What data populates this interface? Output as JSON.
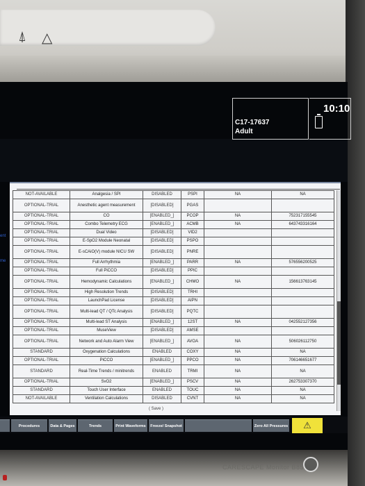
{
  "status": {
    "patient_id": "C17-17637",
    "patient_type": "Adult",
    "time": "10:10"
  },
  "side_labels": [
    "ent",
    "me"
  ],
  "table": {
    "rows": [
      {
        "status": "NOT-AVAILABLE",
        "feature": "Analgesia / SPI",
        "enabled": "DISABLED",
        "code": "PSPI",
        "value": "NA",
        "serial": "NA"
      },
      {
        "status": "OPTIONAL-TRIAL",
        "feature": "Anesthetic agent measurement",
        "enabled": "[DISABLED]",
        "code": "PGAS",
        "value": "",
        "serial": "",
        "tall": true
      },
      {
        "status": "OPTIONAL-TRIAL",
        "feature": "CO",
        "enabled": "[ENABLED_]",
        "code": "PCOP",
        "value": "NA",
        "serial": "752317155545"
      },
      {
        "status": "OPTIONAL-TRIAL",
        "feature": "Combo Telemetry ECG",
        "enabled": "[ENABLED_]",
        "code": "ACMB",
        "value": "NA",
        "serial": "643743316164"
      },
      {
        "status": "OPTIONAL-TRIAL",
        "feature": "Dual Video",
        "enabled": "[DISABLED]",
        "code": "VID2",
        "value": "",
        "serial": ""
      },
      {
        "status": "OPTIONAL-TRIAL",
        "feature": "E-SpO2 Module Neonatal",
        "enabled": "[DISABLED]",
        "code": "PSPO",
        "value": "",
        "serial": ""
      },
      {
        "status": "OPTIONAL-TRIAL",
        "feature": "E-sCAiO(V) module NICU SW",
        "enabled": "[DISABLED]",
        "code": "PNRE",
        "value": "",
        "serial": "",
        "tall": true
      },
      {
        "status": "OPTIONAL-TRIAL",
        "feature": "Full Arrhythmia",
        "enabled": "[ENABLED_]",
        "code": "PARR",
        "value": "NA",
        "serial": "576556200525"
      },
      {
        "status": "OPTIONAL-TRIAL",
        "feature": "Full PiCCO",
        "enabled": "[DISABLED]",
        "code": "PPIC",
        "value": "",
        "serial": ""
      },
      {
        "status": "OPTIONAL-TRIAL",
        "feature": "Hemodynamic Calculations",
        "enabled": "[ENABLED_]",
        "code": "CHMO",
        "value": "NA",
        "serial": "156613763145",
        "tall": true
      },
      {
        "status": "OPTIONAL-TRIAL",
        "feature": "High Resolution Trends",
        "enabled": "[DISABLED]",
        "code": "TRHI",
        "value": "",
        "serial": ""
      },
      {
        "status": "OPTIONAL-TRIAL",
        "feature": "LaunchPad License",
        "enabled": "[DISABLED]",
        "code": "AIPN",
        "value": "",
        "serial": ""
      },
      {
        "status": "OPTIONAL-TRIAL",
        "feature": "Multi-lead QT / QTc Analysis",
        "enabled": "[DISABLED]",
        "code": "PQTC",
        "value": "",
        "serial": "",
        "tall": true
      },
      {
        "status": "OPTIONAL-TRIAL",
        "feature": "Multi-lead ST Analysis",
        "enabled": "[ENABLED_]",
        "code": "12ST",
        "value": "NA",
        "serial": "042552127356"
      },
      {
        "status": "OPTIONAL-TRIAL",
        "feature": "MuseView",
        "enabled": "[DISABLED]",
        "code": "AMSE",
        "value": "",
        "serial": ""
      },
      {
        "status": "OPTIONAL-TRIAL",
        "feature": "Network and Auto Alarm View",
        "enabled": "[ENABLED_]",
        "code": "AVOA",
        "value": "NA",
        "serial": "506026112750",
        "tall": true
      },
      {
        "status": "STANDARD",
        "feature": "Oxygenation Calculations",
        "enabled": "ENABLED",
        "code": "COXY",
        "value": "NA",
        "serial": "NA"
      },
      {
        "status": "OPTIONAL-TRIAL",
        "feature": "PiCCO",
        "enabled": "[ENABLED_]",
        "code": "PPCO",
        "value": "NA",
        "serial": "706146651677"
      },
      {
        "status": "STANDARD",
        "feature": "Real-Time Trends / minitrends",
        "enabled": "ENABLED",
        "code": "TRMI",
        "value": "NA",
        "serial": "NA",
        "tall": true
      },
      {
        "status": "OPTIONAL-TRIAL",
        "feature": "SvO2",
        "enabled": "[ENABLED_]",
        "code": "PSCV",
        "value": "NA",
        "serial": "262753307370"
      },
      {
        "status": "STANDARD",
        "feature": "Touch User Interface",
        "enabled": "ENABLED",
        "code": "TOUC",
        "value": "NA",
        "serial": "NA"
      },
      {
        "status": "NOT-AVAILABLE",
        "feature": "Ventilation Calculations",
        "enabled": "DISABLED",
        "code": "CVNT",
        "value": "NA",
        "serial": "NA"
      }
    ]
  },
  "save_label": "( Save )",
  "buttons": [
    {
      "label": "Procedures"
    },
    {
      "label": "Data & Pages"
    },
    {
      "label": "Trends"
    },
    {
      "label": "Print Waveforms"
    },
    {
      "label": "Freeze/ Snapshot"
    },
    {
      "label": ""
    },
    {
      "label": "Zero All Pressures"
    }
  ],
  "brand": "CARESCAPE Monitor B850",
  "icons": {
    "alarm": "bell-off-icon",
    "warning": "warning-triangle-icon",
    "alarm_button": "alarm-bell-icon"
  },
  "colors": {
    "alarm_button": "#f0e23a",
    "button": "#5d6670",
    "dialog_bg": "#f3f4f6"
  }
}
